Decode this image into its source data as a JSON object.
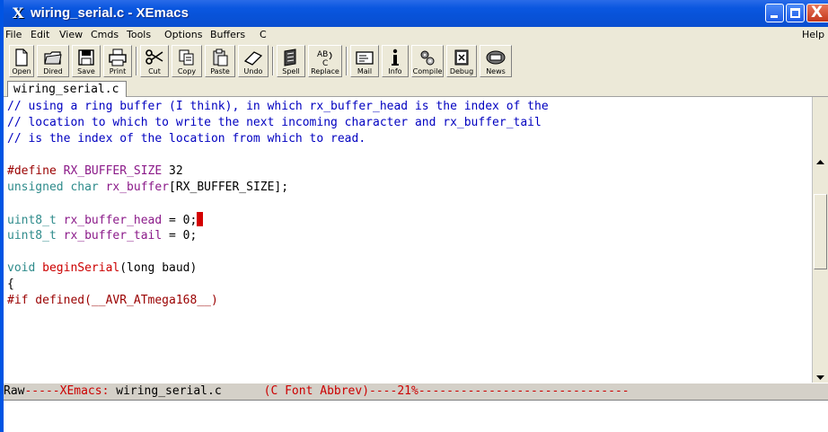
{
  "window": {
    "title": "wiring_serial.c - XEmacs",
    "app_icon": "X",
    "controls": {
      "minimize_icon": "minimize-icon",
      "maximize_icon": "maximize-icon",
      "close_glyph": "X"
    }
  },
  "menubar": {
    "items": [
      "File",
      "Edit",
      "View",
      "Cmds",
      "Tools",
      "Options",
      "Buffers",
      "C"
    ],
    "help": "Help"
  },
  "toolbar": {
    "buttons": [
      {
        "label": "Open",
        "icon": "new-file-icon"
      },
      {
        "label": "Dired",
        "icon": "folder-icon"
      },
      {
        "label": "Save",
        "icon": "floppy-icon"
      },
      {
        "label": "Print",
        "icon": "printer-icon"
      },
      {
        "label": "Cut",
        "icon": "scissors-icon"
      },
      {
        "label": "Copy",
        "icon": "copy-icon"
      },
      {
        "label": "Paste",
        "icon": "clipboard-icon"
      },
      {
        "label": "Undo",
        "icon": "eraser-icon"
      },
      {
        "label": "Spell",
        "icon": "spell-book-icon"
      },
      {
        "label": "Replace",
        "icon": "replace-icon"
      },
      {
        "label": "Mail",
        "icon": "mail-icon"
      },
      {
        "label": "Info",
        "icon": "info-icon"
      },
      {
        "label": "Compile",
        "icon": "gears-icon"
      },
      {
        "label": "Debug",
        "icon": "bug-icon"
      },
      {
        "label": "News",
        "icon": "news-icon"
      }
    ]
  },
  "buffer_tab": {
    "name": "wiring_serial.c"
  },
  "editor": {
    "lines": [
      [
        {
          "t": "// using a ring buffer (I think), in which rx_buffer_head is the index of the",
          "c": "comment"
        }
      ],
      [
        {
          "t": "// location to which to write the next incoming character and rx_buffer_tail",
          "c": "comment"
        }
      ],
      [
        {
          "t": "// is the index of the location from which to read.",
          "c": "comment"
        }
      ],
      [],
      [
        {
          "t": "#define ",
          "c": "pre"
        },
        {
          "t": "RX_BUFFER_SIZE",
          "c": "var"
        },
        {
          "t": " 32",
          "c": "plain"
        }
      ],
      [
        {
          "t": "unsigned char ",
          "c": "type"
        },
        {
          "t": "rx_buffer",
          "c": "var"
        },
        {
          "t": "[RX_BUFFER_SIZE];",
          "c": "plain"
        }
      ],
      [],
      [
        {
          "t": "uint8_t ",
          "c": "type"
        },
        {
          "t": "rx_buffer_head",
          "c": "var"
        },
        {
          "t": " = 0;",
          "c": "plain"
        },
        {
          "t": "",
          "c": "cursor"
        }
      ],
      [
        {
          "t": "uint8_t ",
          "c": "type"
        },
        {
          "t": "rx_buffer_tail",
          "c": "var"
        },
        {
          "t": " = 0;",
          "c": "plain"
        }
      ],
      [],
      [
        {
          "t": "void ",
          "c": "type"
        },
        {
          "t": "beginSerial",
          "c": "fn"
        },
        {
          "t": "(long baud)",
          "c": "plain"
        }
      ],
      [
        {
          "t": "{",
          "c": "plain"
        }
      ],
      [
        {
          "t": "#if defined(__AVR_ATmega168__)",
          "c": "pre"
        }
      ]
    ]
  },
  "modeline": {
    "segments": [
      {
        "t": "Raw",
        "c": "plain"
      },
      {
        "t": "-----",
        "c": "dash"
      },
      {
        "t": "XEmacs: ",
        "c": "mode"
      },
      {
        "t": "wiring_serial.c",
        "c": "bufname"
      },
      {
        "t": "      ",
        "c": "plain"
      },
      {
        "t": "(C Font Abbrev)",
        "c": "mode"
      },
      {
        "t": "----21%------------------------------",
        "c": "dash"
      }
    ]
  },
  "colors": {
    "titlebar": "#0a57e0",
    "comment": "#0000c0",
    "preprocessor": "#9a0000",
    "type": "#2e8b8b",
    "variable": "#8b1a89",
    "function": "#cc0000",
    "cursor": "#d40000"
  }
}
